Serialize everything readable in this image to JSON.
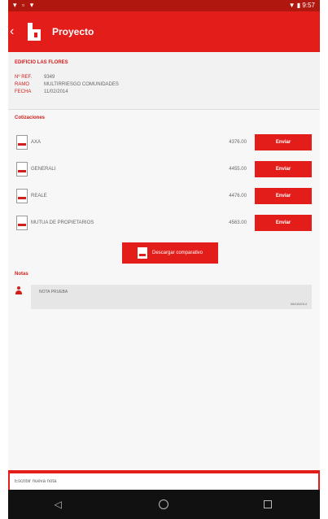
{
  "statusbar": {
    "left_icons": [
      "notification-icon",
      "notification-icon",
      "wifi-icon"
    ],
    "time": "9:57"
  },
  "appbar": {
    "title": "Proyecto"
  },
  "project": {
    "name": "EDIFICIO LAS FLORES",
    "fields": [
      {
        "label": "Nº REF.",
        "value": "9349"
      },
      {
        "label": "RAMO",
        "value": "MULTIRRIESGO COMUNIDADES"
      },
      {
        "label": "FECHA",
        "value": "11/02/2014"
      }
    ]
  },
  "quotes": {
    "title": "Cotizaciones",
    "button_label": "Enviar",
    "items": [
      {
        "name": "AXA",
        "price": "4376.00"
      },
      {
        "name": "GENERALI",
        "price": "4455.00"
      },
      {
        "name": "REALE",
        "price": "4476.00"
      },
      {
        "name": "MUTUA DE PROPIETARIOS",
        "price": "4563.00"
      }
    ]
  },
  "download": {
    "label": "Descargar comparativo"
  },
  "notes": {
    "title": "Notas",
    "items": [
      {
        "text": "NOTA PRUEBA",
        "date": "06/16/2014"
      }
    ]
  },
  "compose": {
    "placeholder": "Escribir nueva nota"
  },
  "navbar": {
    "icons": [
      "back-icon",
      "home-icon",
      "recent-apps-icon"
    ]
  },
  "colors": {
    "brand": "#e31d1a",
    "status": "#b0170f",
    "accent_text": "#d01f1b"
  }
}
